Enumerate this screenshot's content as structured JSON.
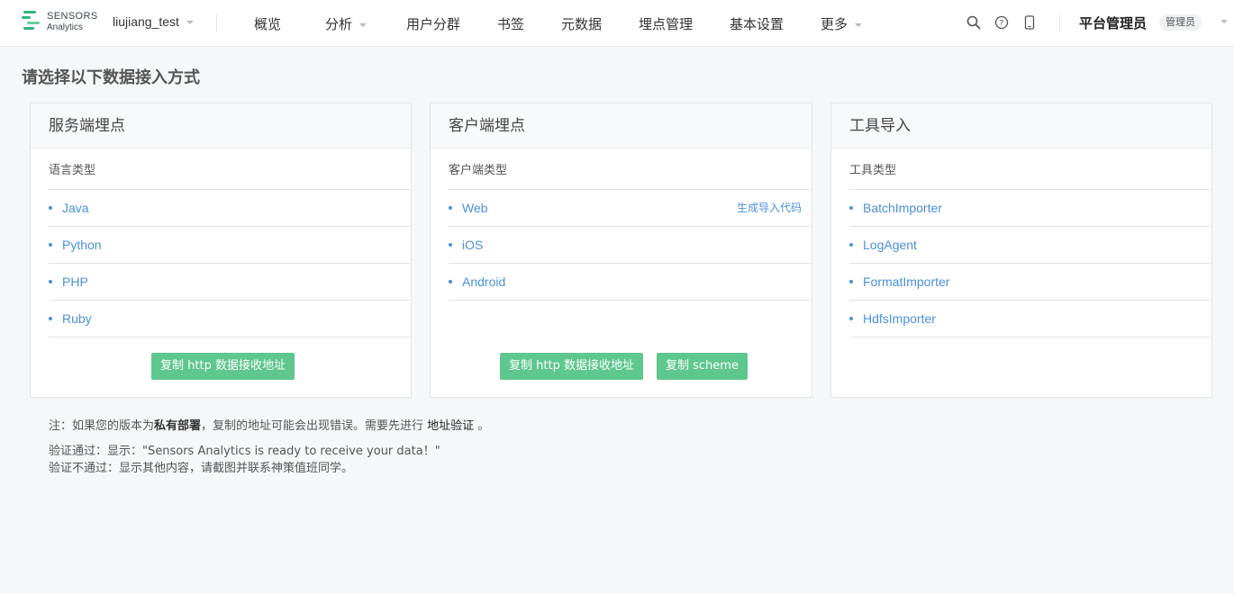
{
  "logo": {
    "line1": "SENSORS",
    "line2": "Analytics"
  },
  "header": {
    "project": "liujiang_test",
    "nav": [
      "概览",
      "分析",
      "用户分群",
      "书签",
      "元数据",
      "埋点管理",
      "基本设置",
      "更多"
    ],
    "user_name": "平台管理员",
    "user_badge": "管理员"
  },
  "page": {
    "title": "请选择以下数据接入方式"
  },
  "cards": [
    {
      "title": "服务端埋点",
      "subtitle": "语言类型",
      "items": [
        "Java",
        "Python",
        "PHP",
        "Ruby"
      ],
      "buttons": [
        "复制 http 数据接收地址"
      ]
    },
    {
      "title": "客户端埋点",
      "subtitle": "客户端类型",
      "items": [
        "Web",
        "iOS",
        "Android"
      ],
      "item_action": "生成导入代码",
      "buttons": [
        "复制 http 数据接收地址",
        "复制 scheme"
      ]
    },
    {
      "title": "工具导入",
      "subtitle": "工具类型",
      "items": [
        "BatchImporter",
        "LogAgent",
        "FormatImporter",
        "HdfsImporter"
      ],
      "buttons": []
    }
  ],
  "notes": {
    "prefix": "注：如果您的版本为",
    "bold": "私有部署",
    "middle": "，复制的地址可能会出现错误。需要先进行 ",
    "link": "地址验证",
    "suffix": " 。",
    "pass": "验证通过：显示：\"Sensors Analytics is ready to receive your data！\"",
    "fail": "验证不通过：显示其他内容，请截图并联系神策值班同学。"
  },
  "colors": {
    "accent": "#4a90d9",
    "button": "#5ec78d"
  },
  "icons": [
    "search-icon",
    "help-icon",
    "mobile-icon"
  ]
}
